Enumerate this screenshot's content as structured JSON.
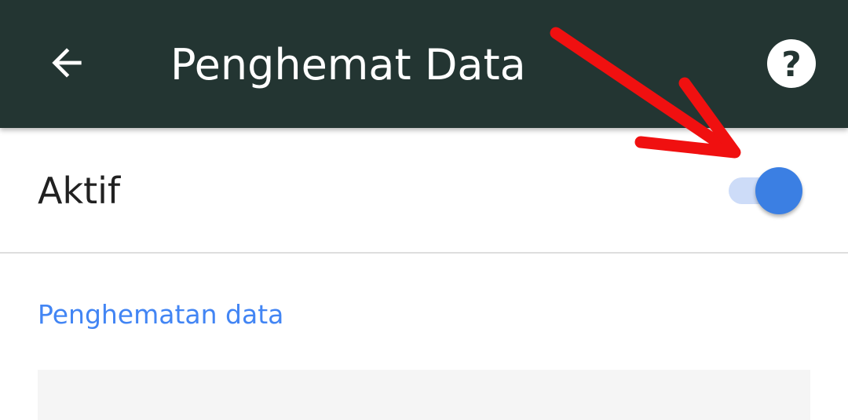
{
  "toolbar": {
    "title": "Penghemat Data",
    "back_icon": "arrow-back-icon",
    "help_icon": "help-circle-icon",
    "background_color": "#233532"
  },
  "settings": {
    "active_label": "Aktif",
    "active_toggle_on": true,
    "toggle_color": "#3b7fe3"
  },
  "section": {
    "header": "Penghematan data",
    "header_color": "#4285f4"
  },
  "annotation": {
    "arrow_color": "#f01010"
  }
}
